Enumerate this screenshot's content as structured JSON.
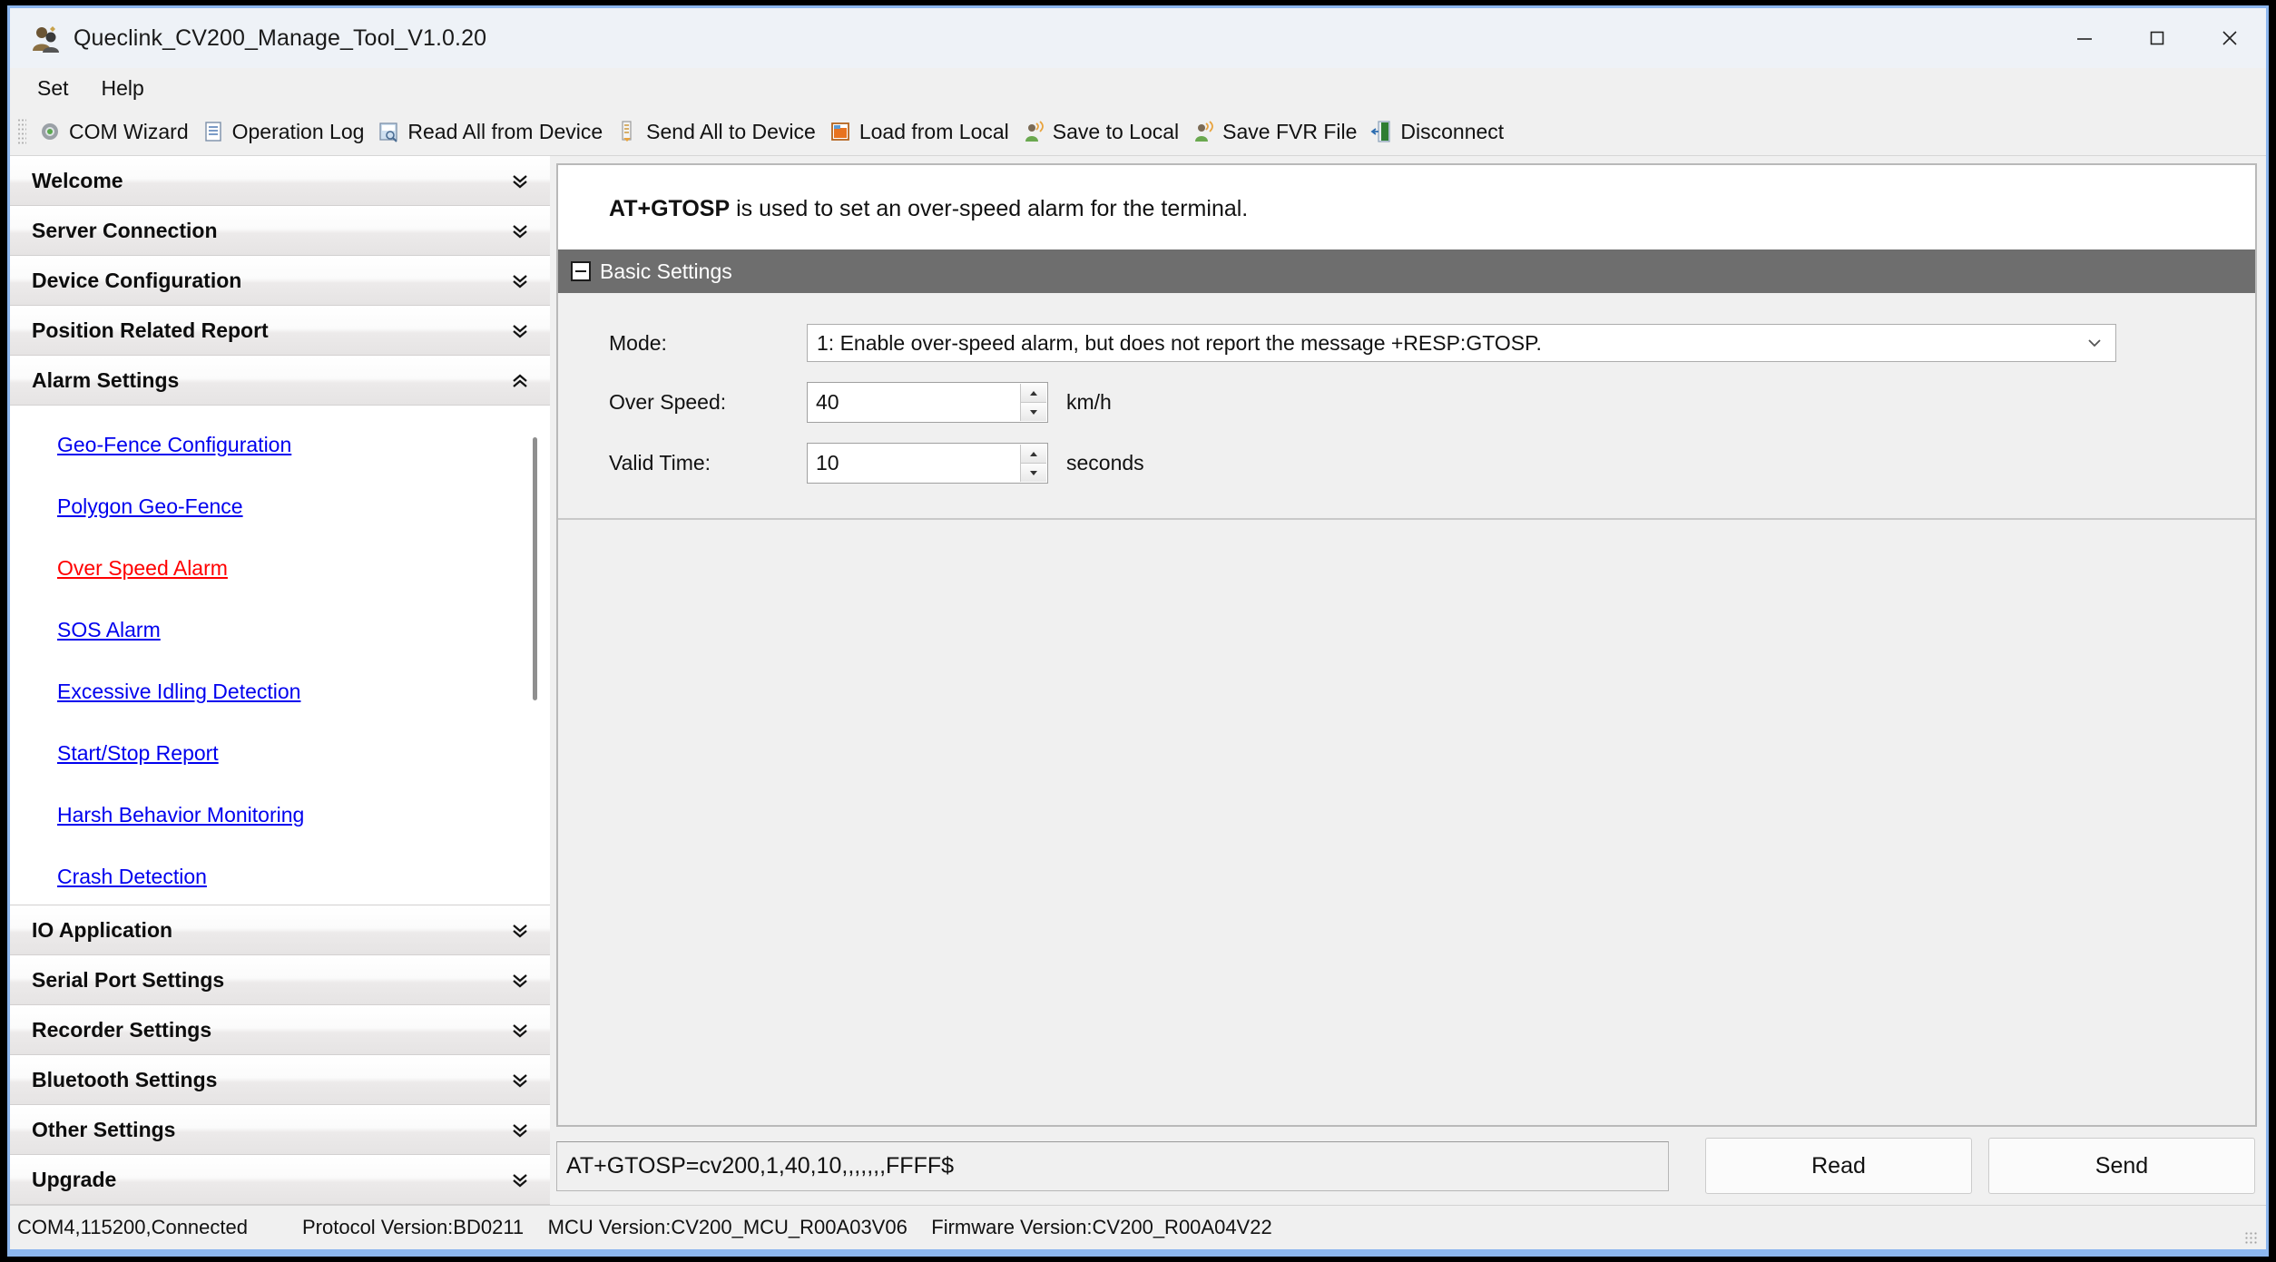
{
  "window": {
    "title": "Queclink_CV200_Manage_Tool_V1.0.20",
    "app_icon": "app-icon",
    "minimize_label": "Minimize",
    "maximize_label": "Maximize",
    "close_label": "Close"
  },
  "menubar": {
    "items": [
      {
        "label": "Set"
      },
      {
        "label": "Help"
      }
    ]
  },
  "toolbar": {
    "items": [
      {
        "label": "COM Wizard",
        "icon": "gear-icon"
      },
      {
        "label": "Operation Log",
        "icon": "log-icon"
      },
      {
        "label": "Read All from Device",
        "icon": "read-device-icon"
      },
      {
        "label": "Send All to Device",
        "icon": "send-device-icon"
      },
      {
        "label": "Load from Local",
        "icon": "load-local-icon"
      },
      {
        "label": "Save to Local",
        "icon": "save-local-icon"
      },
      {
        "label": "Save FVR File",
        "icon": "save-fvr-icon"
      },
      {
        "label": "Disconnect",
        "icon": "disconnect-icon"
      }
    ]
  },
  "sidebar": {
    "sections_top": [
      {
        "label": "Welcome",
        "expanded": false
      },
      {
        "label": "Server Connection",
        "expanded": false
      },
      {
        "label": "Device Configuration",
        "expanded": false
      },
      {
        "label": "Position Related Report",
        "expanded": false
      },
      {
        "label": "Alarm Settings",
        "expanded": true
      }
    ],
    "alarm_links": [
      {
        "label": "Geo-Fence Configuration",
        "active": false
      },
      {
        "label": "Polygon Geo-Fence",
        "active": false
      },
      {
        "label": "Over Speed Alarm",
        "active": true
      },
      {
        "label": "SOS Alarm",
        "active": false
      },
      {
        "label": "Excessive Idling Detection",
        "active": false
      },
      {
        "label": "Start/Stop Report",
        "active": false
      },
      {
        "label": "Harsh Behavior Monitoring",
        "active": false
      },
      {
        "label": "Crash Detection",
        "active": false
      }
    ],
    "sections_bottom": [
      {
        "label": "IO Application",
        "expanded": false
      },
      {
        "label": "Serial Port Settings",
        "expanded": false
      },
      {
        "label": "Recorder Settings",
        "expanded": false
      },
      {
        "label": "Bluetooth Settings",
        "expanded": false
      },
      {
        "label": "Other Settings",
        "expanded": false
      },
      {
        "label": "Upgrade",
        "expanded": false
      }
    ]
  },
  "main": {
    "description_command": "AT+GTOSP",
    "description_rest": " is used to set an over-speed alarm for the terminal.",
    "group": {
      "title": "Basic Settings",
      "collapse_icon": "collapse-minus-icon"
    },
    "fields": {
      "mode": {
        "label": "Mode:",
        "value": "1: Enable over-speed alarm, but does not report the message +RESP:GTOSP.",
        "dropdown_icon": "chevron-down-icon"
      },
      "over_speed": {
        "label": "Over Speed:",
        "value": "40",
        "unit": "km/h"
      },
      "valid_time": {
        "label": "Valid Time:",
        "value": "10",
        "unit": "seconds"
      }
    }
  },
  "command_bar": {
    "command": "AT+GTOSP=cv200,1,40,10,,,,,,,FFFF$",
    "placeholder": "",
    "read_label": "Read",
    "send_label": "Send"
  },
  "statusbar": {
    "connection": "COM4,115200,Connected",
    "protocol_version": "Protocol Version:BD0211",
    "mcu_version": "MCU Version:CV200_MCU_R00A03V06",
    "firmware_version": "Firmware Version:CV200_R00A04V22"
  },
  "colors": {
    "window_border": "#8cb6ee",
    "group_header_bg": "#6e6e6e",
    "link": "#0000ee",
    "link_active": "#ff0000",
    "panel_bg": "#f0f0f0"
  }
}
